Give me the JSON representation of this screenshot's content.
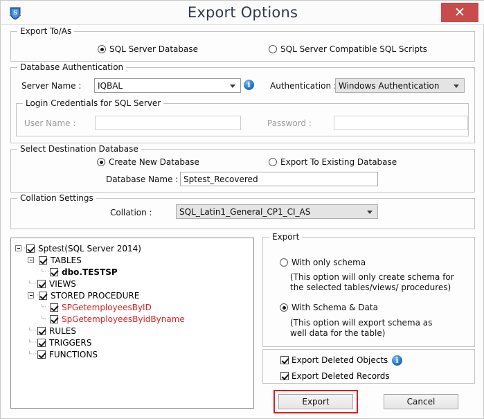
{
  "window": {
    "title": "Export Options",
    "app_icon": "shield-icon",
    "close_label": "✕",
    "close_color": "#c94c4c"
  },
  "export_to_as": {
    "group_title": "Export To/As",
    "options": [
      {
        "label": "SQL Server Database",
        "selected": true
      },
      {
        "label": "SQL Server Compatible SQL Scripts",
        "selected": false
      }
    ]
  },
  "database_authentication": {
    "group_title": "Database Authentication",
    "server_name_label": "Server Name :",
    "server_name_value": "IQBAL",
    "info_icon": "info-icon",
    "info_glyph": "i",
    "authentication_label": "Authentication :",
    "authentication_value": "Windows Authentication",
    "login_credentials": {
      "group_title": "Login Credentials for SQL Server",
      "user_name_label": "User Name :",
      "user_name_value": "",
      "password_label": "Password :",
      "password_value": "",
      "disabled": true
    }
  },
  "destination_database": {
    "group_title": "Select Destination Database",
    "options": [
      {
        "label": "Create New Database",
        "selected": true
      },
      {
        "label": "Export To Existing Database",
        "selected": false
      }
    ],
    "database_name_label": "Database Name :",
    "database_name_value": "Sptest_Recovered"
  },
  "collation_settings": {
    "group_title": "Collation Settings",
    "collation_label": "Collation :",
    "collation_value": "SQL_Latin1_General_CP1_CI_AS"
  },
  "tree": {
    "nodes": [
      {
        "label": "Sptest(SQL Server 2014)",
        "indent": 0,
        "expander": true,
        "checked": true,
        "color": "normal",
        "bold": false
      },
      {
        "label": "TABLES",
        "indent": 1,
        "expander": true,
        "checked": true,
        "color": "normal",
        "bold": false
      },
      {
        "label": "dbo.TESTSP",
        "indent": 2,
        "expander": false,
        "checked": true,
        "color": "normal",
        "bold": true
      },
      {
        "label": "VIEWS",
        "indent": 1,
        "expander": false,
        "checked": true,
        "color": "normal",
        "bold": false
      },
      {
        "label": "STORED PROCEDURE",
        "indent": 1,
        "expander": true,
        "checked": true,
        "color": "normal",
        "bold": false
      },
      {
        "label": "SPGetemployeesByID",
        "indent": 2,
        "expander": false,
        "checked": true,
        "color": "red",
        "bold": false
      },
      {
        "label": "SpGetemployeesByidByname",
        "indent": 2,
        "expander": false,
        "checked": true,
        "color": "red",
        "bold": false
      },
      {
        "label": "RULES",
        "indent": 1,
        "expander": false,
        "checked": true,
        "color": "normal",
        "bold": false
      },
      {
        "label": "TRIGGERS",
        "indent": 1,
        "expander": false,
        "checked": true,
        "color": "normal",
        "bold": false
      },
      {
        "label": "FUNCTIONS",
        "indent": 1,
        "expander": false,
        "checked": true,
        "color": "normal",
        "bold": false
      }
    ]
  },
  "export_panel": {
    "group_title": "Export",
    "option_schema_only": {
      "label": "With only schema",
      "selected": false,
      "hint": "(This option will only create schema for\nthe  selected tables/views/ procedures)"
    },
    "option_schema_and_data": {
      "label": "With Schema & Data",
      "selected": true,
      "hint": "(This option will export schema as\nwell data for the table)"
    }
  },
  "deleted_options": {
    "export_deleted_objects": {
      "label": "Export Deleted Objects",
      "checked": true
    },
    "export_deleted_records": {
      "label": "Export Deleted Records",
      "checked": true
    },
    "info_icon": "info-icon",
    "info_glyph": "i"
  },
  "actions": {
    "export_label": "Export",
    "cancel_label": "Cancel",
    "export_highlight_color": "#e01b1b"
  }
}
